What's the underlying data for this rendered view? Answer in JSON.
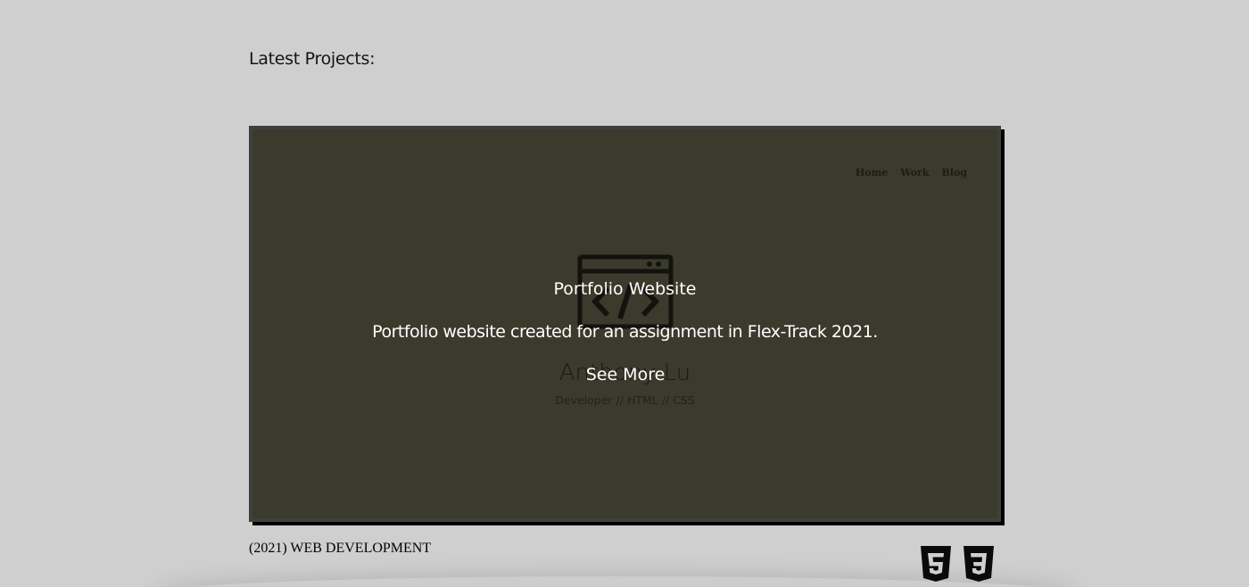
{
  "section": {
    "heading": "Latest Projects:"
  },
  "project": {
    "preview": {
      "nav": [
        "Home",
        "Work",
        "Blog"
      ],
      "name": "Anthony Lu",
      "role": "Developer // HTML // CSS",
      "icon": "code-window-icon"
    },
    "overlay": {
      "title": "Portfolio Website",
      "description": "Portfolio website created for an assignment in Flex-Track 2021.",
      "link_label": "See More"
    },
    "caption": "(2021) WEB DEVELOPMENT",
    "tech_icons": [
      "html5-icon",
      "css3-icon"
    ]
  },
  "colors": {
    "page_background": "#cfcfcf",
    "card_background": "#3b3a2e",
    "overlay_text": "#ffffff"
  }
}
